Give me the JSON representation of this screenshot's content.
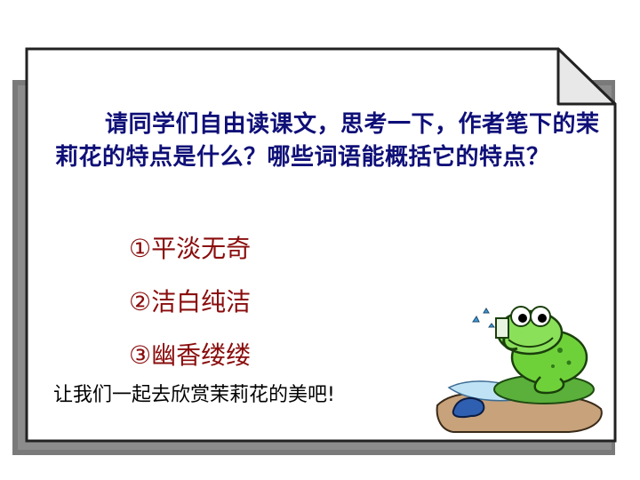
{
  "slide": {
    "question": "请同学们自由读课文，思考一下，作者笔下的茉莉花的特点是什么？哪些词语能概括它的特点？",
    "points": [
      "①平淡无奇",
      "②洁白纯洁",
      "③幽香缕缕"
    ],
    "invite": "让我们一起去欣赏茉莉花的美吧!"
  },
  "colors": {
    "question_text": "#0f0f78",
    "points_text": "#8a0c0c",
    "card_shadow": "#7a7a7a",
    "card_border": "#222222",
    "frog_green": "#6fd13a"
  }
}
